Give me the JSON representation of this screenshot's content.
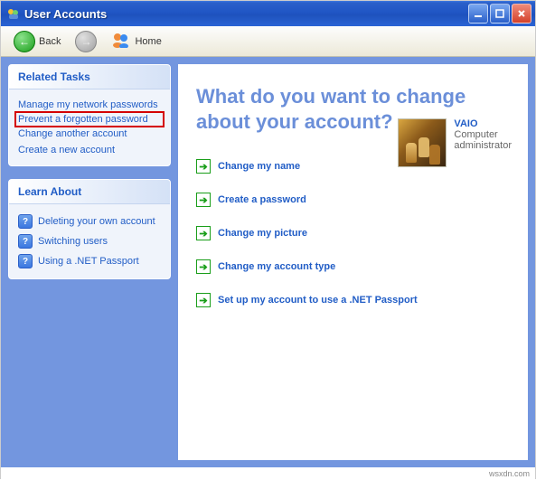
{
  "window": {
    "title": "User Accounts"
  },
  "toolbar": {
    "back": "Back",
    "home": "Home"
  },
  "sidebar": {
    "tasks_heading": "Related Tasks",
    "tasks": [
      "Manage my network passwords",
      "Prevent a forgotten password",
      "Change another account",
      "Create a new account"
    ],
    "learn_heading": "Learn About",
    "learn": [
      "Deleting your own account",
      "Switching users",
      "Using a .NET Passport"
    ]
  },
  "main": {
    "heading": "What do you want to change about your account?",
    "actions": [
      "Change my name",
      "Create a password",
      "Change my picture",
      "Change my account type",
      "Set up my account to use a .NET Passport"
    ],
    "user": {
      "name": "VAIO",
      "role1": "Computer",
      "role2": "administrator"
    }
  },
  "footer": "wsxdn.com"
}
